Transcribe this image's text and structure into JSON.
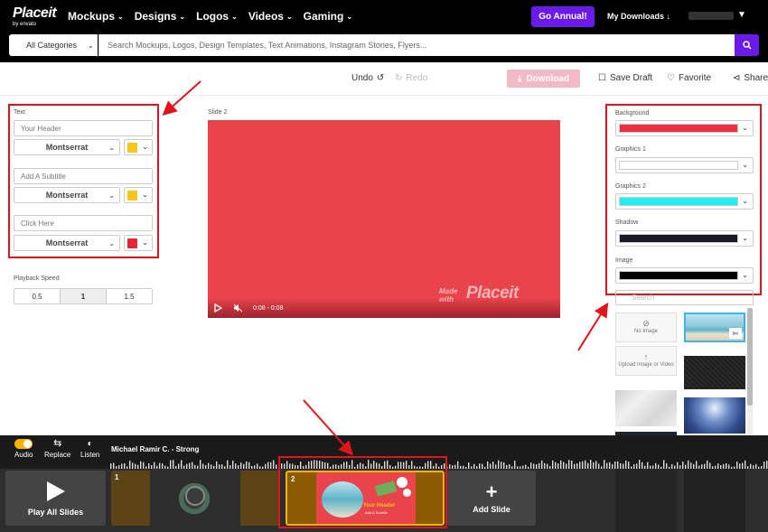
{
  "brand": {
    "name": "Placeit",
    "sub": "by envato"
  },
  "nav": {
    "items": [
      "Mockups",
      "Designs",
      "Logos",
      "Videos",
      "Gaming"
    ]
  },
  "header": {
    "go_annual": "Go Annual!",
    "my_downloads": "My Downloads"
  },
  "search": {
    "category": "All Categories",
    "placeholder": "Search Mockups, Logos, Design Templates, Text Animations, Instagram Stories, Flyers..."
  },
  "toolbar": {
    "undo": "Undo",
    "redo": "Redo",
    "download": "Download",
    "save_draft": "Save Draft",
    "favorite": "Favorite",
    "share": "Share"
  },
  "text_panel": {
    "title": "Text",
    "fields": [
      {
        "placeholder": "Your Header",
        "font": "Montserrat",
        "color": "#f5c518"
      },
      {
        "placeholder": "Add A Subtitle",
        "font": "Montserrat",
        "color": "#f5c518"
      },
      {
        "placeholder": "Click Here",
        "font": "Montserrat",
        "color": "#e8243a"
      }
    ]
  },
  "playback": {
    "label": "Playback Speed",
    "options": [
      "0.5",
      "1",
      "1.5"
    ],
    "selected": "1"
  },
  "preview": {
    "slide_label": "Slide 2",
    "time": "0:08 - 0:08",
    "watermark_made": "Made with",
    "watermark_brand": "Placeit",
    "bg_color": "#e9434b"
  },
  "colors_panel": {
    "items": [
      {
        "label": "Background",
        "color": "#e8333f"
      },
      {
        "label": "Graphics 1",
        "color": "#ffffff"
      },
      {
        "label": "Graphics 2",
        "color": "#1ff0ee"
      },
      {
        "label": "Shadow",
        "color": "#1a1a26"
      },
      {
        "label": "Image",
        "color": "#000000"
      }
    ]
  },
  "image_picker": {
    "search_placeholder": "Search",
    "no_image": "No Image",
    "upload": "Upload Image or Video"
  },
  "audio": {
    "audio_label": "Audio",
    "replace_label": "Replace",
    "listen_label": "Listen",
    "track": "Michael Ramir C. - Strong"
  },
  "timeline": {
    "play_all": "Play All Slides",
    "slides": [
      {
        "num": "1"
      },
      {
        "num": "2"
      }
    ],
    "add_slide": "Add Slide"
  },
  "slide2_thumb": {
    "header": "Your Header",
    "subtitle": "Add A Subtitle"
  }
}
